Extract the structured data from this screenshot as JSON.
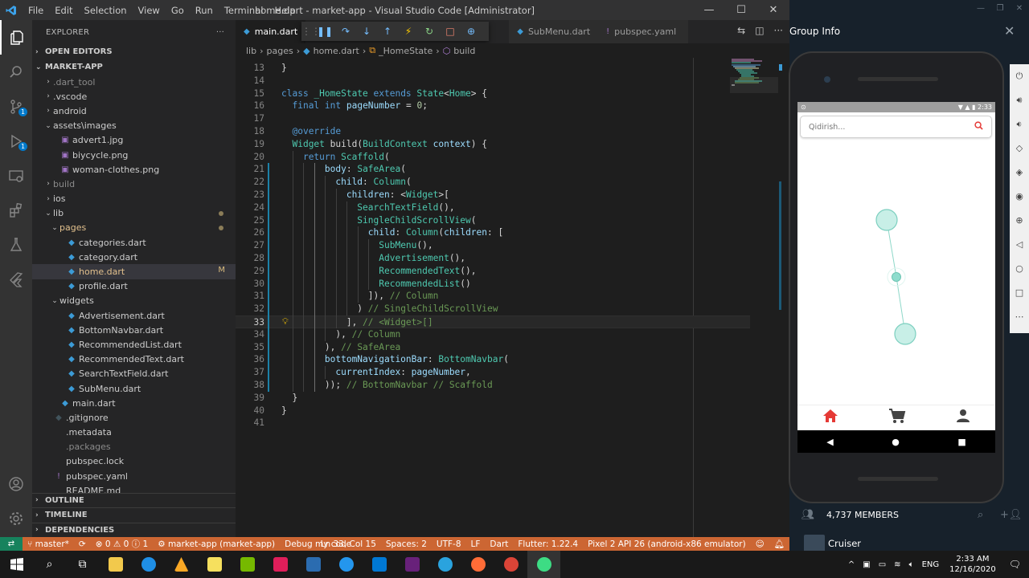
{
  "window": {
    "title": "home.dart - market-app - Visual Studio Code [Administrator]",
    "menu": [
      "File",
      "Edit",
      "Selection",
      "View",
      "Go",
      "Run",
      "Terminal",
      "Help"
    ]
  },
  "explorer": {
    "header": "EXPLORER",
    "more": "···",
    "open_editors": "OPEN EDITORS",
    "project": "MARKET-APP",
    "tree": [
      {
        "label": ".dart_tool",
        "depth": 1,
        "kind": "folder",
        "open": false,
        "dim": true
      },
      {
        "label": ".vscode",
        "depth": 1,
        "kind": "folder",
        "open": false
      },
      {
        "label": "android",
        "depth": 1,
        "kind": "folder",
        "open": false
      },
      {
        "label": "assets\\images",
        "depth": 1,
        "kind": "folder",
        "open": true
      },
      {
        "label": "advert1.jpg",
        "depth": 2,
        "kind": "image"
      },
      {
        "label": "biycycle.png",
        "depth": 2,
        "kind": "image"
      },
      {
        "label": "woman-clothes.png",
        "depth": 2,
        "kind": "image"
      },
      {
        "label": "build",
        "depth": 1,
        "kind": "folder",
        "open": false,
        "dim": true
      },
      {
        "label": "ios",
        "depth": 1,
        "kind": "folder",
        "open": false
      },
      {
        "label": "lib",
        "depth": 1,
        "kind": "folder",
        "open": true,
        "mark": "dot"
      },
      {
        "label": "pages",
        "depth": 2,
        "kind": "folder",
        "open": true,
        "mark": "dot",
        "orange": true
      },
      {
        "label": "categories.dart",
        "depth": 3,
        "kind": "dart"
      },
      {
        "label": "category.dart",
        "depth": 3,
        "kind": "dart"
      },
      {
        "label": "home.dart",
        "depth": 3,
        "kind": "dart",
        "selected": true,
        "mark": "M",
        "orange": true
      },
      {
        "label": "profile.dart",
        "depth": 3,
        "kind": "dart"
      },
      {
        "label": "widgets",
        "depth": 2,
        "kind": "folder",
        "open": true
      },
      {
        "label": "Advertisement.dart",
        "depth": 3,
        "kind": "dart"
      },
      {
        "label": "BottomNavbar.dart",
        "depth": 3,
        "kind": "dart"
      },
      {
        "label": "RecommendedList.dart",
        "depth": 3,
        "kind": "dart"
      },
      {
        "label": "RecommendedText.dart",
        "depth": 3,
        "kind": "dart"
      },
      {
        "label": "SearchTextField.dart",
        "depth": 3,
        "kind": "dart"
      },
      {
        "label": "SubMenu.dart",
        "depth": 3,
        "kind": "dart"
      },
      {
        "label": "main.dart",
        "depth": 2,
        "kind": "dart"
      },
      {
        "label": ".gitignore",
        "depth": 1,
        "kind": "git"
      },
      {
        "label": ".metadata",
        "depth": 1,
        "kind": "file"
      },
      {
        "label": ".packages",
        "depth": 1,
        "kind": "file",
        "dim": true
      },
      {
        "label": "pubspec.lock",
        "depth": 1,
        "kind": "file"
      },
      {
        "label": "pubspec.yaml",
        "depth": 1,
        "kind": "yaml"
      },
      {
        "label": "README.md",
        "depth": 1,
        "kind": "file"
      }
    ],
    "outline": "OUTLINE",
    "timeline": "TIMELINE",
    "dependencies": "DEPENDENCIES"
  },
  "activity_badges": {
    "scm": "1",
    "debug": "1"
  },
  "tabs": [
    {
      "label": "main.dart",
      "active": false,
      "icon": "dart-icon"
    },
    {
      "label": "SubMenu.dart",
      "active": false,
      "icon": "dart-icon"
    },
    {
      "label": "pubspec.yaml",
      "active": false,
      "icon": "yaml-icon"
    }
  ],
  "breadcrumb": [
    "lib",
    "pages",
    "home.dart",
    "_HomeState",
    "build"
  ],
  "editor": {
    "current_line": 33,
    "lines": [
      {
        "n": "13",
        "indent": 0,
        "tokens": [
          [
            "pl",
            "}"
          ]
        ]
      },
      {
        "n": "14",
        "indent": 0,
        "tokens": []
      },
      {
        "n": "15",
        "indent": 0,
        "tokens": [
          [
            "kw",
            "class "
          ],
          [
            "ty",
            "_HomeState "
          ],
          [
            "kw",
            "extends "
          ],
          [
            "ty",
            "State"
          ],
          [
            "pl",
            "<"
          ],
          [
            "ty",
            "Home"
          ],
          [
            "pl",
            "> {"
          ]
        ]
      },
      {
        "n": "16",
        "indent": 1,
        "tokens": [
          [
            "kw",
            "final "
          ],
          [
            "kw",
            "int "
          ],
          [
            "id",
            "pageNumber"
          ],
          [
            "pl",
            " = "
          ],
          [
            "nm",
            "0"
          ],
          [
            "pl",
            ";"
          ]
        ]
      },
      {
        "n": "17",
        "indent": 0,
        "tokens": []
      },
      {
        "n": "18",
        "indent": 1,
        "tokens": [
          [
            "an",
            "@override"
          ]
        ]
      },
      {
        "n": "19",
        "indent": 1,
        "tokens": [
          [
            "ty",
            "Widget "
          ],
          [
            "pl",
            "build("
          ],
          [
            "ty",
            "BuildContext "
          ],
          [
            "id",
            "context"
          ],
          [
            "pl",
            ") {"
          ]
        ]
      },
      {
        "n": "20",
        "indent": 2,
        "tokens": [
          [
            "kw",
            "return "
          ],
          [
            "fn",
            "Scaffold"
          ],
          [
            "pl",
            "("
          ]
        ]
      },
      {
        "n": "21",
        "indent": 4,
        "tokens": [
          [
            "id",
            "body"
          ],
          [
            "pl",
            ": "
          ],
          [
            "fn",
            "SafeArea"
          ],
          [
            "pl",
            "("
          ]
        ]
      },
      {
        "n": "22",
        "indent": 5,
        "tokens": [
          [
            "id",
            "child"
          ],
          [
            "pl",
            ": "
          ],
          [
            "fn",
            "Column"
          ],
          [
            "pl",
            "("
          ]
        ]
      },
      {
        "n": "23",
        "indent": 6,
        "tokens": [
          [
            "id",
            "children"
          ],
          [
            "pl",
            ": <"
          ],
          [
            "ty",
            "Widget"
          ],
          [
            "pl",
            ">["
          ]
        ]
      },
      {
        "n": "24",
        "indent": 7,
        "tokens": [
          [
            "fn",
            "SearchTextField"
          ],
          [
            "pl",
            "(),"
          ]
        ]
      },
      {
        "n": "25",
        "indent": 7,
        "tokens": [
          [
            "fn",
            "SingleChildScrollView"
          ],
          [
            "pl",
            "("
          ]
        ]
      },
      {
        "n": "26",
        "indent": 8,
        "tokens": [
          [
            "id",
            "child"
          ],
          [
            "pl",
            ": "
          ],
          [
            "fn",
            "Column"
          ],
          [
            "pl",
            "("
          ],
          [
            "id",
            "children"
          ],
          [
            "pl",
            ": ["
          ]
        ]
      },
      {
        "n": "27",
        "indent": 9,
        "tokens": [
          [
            "fn",
            "SubMenu"
          ],
          [
            "pl",
            "(),"
          ]
        ]
      },
      {
        "n": "28",
        "indent": 9,
        "tokens": [
          [
            "fn",
            "Advertisement"
          ],
          [
            "pl",
            "(),"
          ]
        ]
      },
      {
        "n": "29",
        "indent": 9,
        "tokens": [
          [
            "fn",
            "RecommendedText"
          ],
          [
            "pl",
            "(),"
          ]
        ]
      },
      {
        "n": "30",
        "indent": 9,
        "tokens": [
          [
            "fn",
            "RecommendedList"
          ],
          [
            "pl",
            "()"
          ]
        ]
      },
      {
        "n": "31",
        "indent": 8,
        "tokens": [
          [
            "pl",
            "]), "
          ],
          [
            "cm",
            "// Column"
          ]
        ]
      },
      {
        "n": "32",
        "indent": 7,
        "tokens": [
          [
            "pl",
            ") "
          ],
          [
            "cm",
            "// SingleChildScrollView"
          ]
        ]
      },
      {
        "n": "33",
        "indent": 6,
        "tokens": [
          [
            "pl",
            "], "
          ],
          [
            "cm",
            "// <Widget>[]"
          ]
        ]
      },
      {
        "n": "34",
        "indent": 5,
        "tokens": [
          [
            "pl",
            "), "
          ],
          [
            "cm",
            "// Column"
          ]
        ]
      },
      {
        "n": "35",
        "indent": 4,
        "tokens": [
          [
            "pl",
            "), "
          ],
          [
            "cm",
            "// SafeArea"
          ]
        ]
      },
      {
        "n": "36",
        "indent": 4,
        "tokens": [
          [
            "id",
            "bottomNavigationBar"
          ],
          [
            "pl",
            ": "
          ],
          [
            "fn",
            "BottomNavbar"
          ],
          [
            "pl",
            "("
          ]
        ]
      },
      {
        "n": "37",
        "indent": 5,
        "tokens": [
          [
            "id",
            "currentIndex"
          ],
          [
            "pl",
            ": "
          ],
          [
            "id",
            "pageNumber"
          ],
          [
            "pl",
            ","
          ]
        ]
      },
      {
        "n": "38",
        "indent": 4,
        "tokens": [
          [
            "pl",
            ")); "
          ],
          [
            "cm",
            "// BottomNavbar // Scaffold"
          ]
        ]
      },
      {
        "n": "39",
        "indent": 1,
        "tokens": [
          [
            "pl",
            "}"
          ]
        ]
      },
      {
        "n": "40",
        "indent": 0,
        "tokens": [
          [
            "pl",
            "}"
          ]
        ]
      },
      {
        "n": "41",
        "indent": 0,
        "tokens": []
      }
    ]
  },
  "statusbar": {
    "branch": "master*",
    "sync": "⟳",
    "problems": "⊗ 0 ⚠ 0 ⓘ 1",
    "project": "market-app (market-app)",
    "mode": "Debug my code",
    "position": "Ln 33, Col 15",
    "spaces": "Spaces: 2",
    "encoding": "UTF-8",
    "eol": "LF",
    "language": "Dart",
    "flutter": "Flutter: 1.22.4",
    "device": "Pixel 2 API 26 (android-x86 emulator)"
  },
  "telegram": {
    "title": "Group Info",
    "members": "4,737 MEMBERS",
    "user": "Cruiser"
  },
  "emulator": {
    "time": "2:33",
    "search_placeholder": "Qidirish..."
  },
  "taskbar": {
    "lang": "ENG",
    "time": "2:33 AM",
    "date": "12/16/2020"
  },
  "colors": {
    "statusbar": "#cc6633",
    "accent": "#007acc",
    "nav_active": "#e53935"
  }
}
